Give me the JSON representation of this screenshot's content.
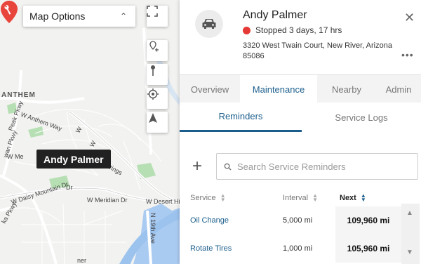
{
  "map": {
    "options_label": "Map Options",
    "labels": {
      "anthem": "ANTHEM",
      "anthem_way": "W Anthem Way",
      "daisy_mountain": "W Daisy Mountain Dr",
      "meridian": "W Meridian Dr",
      "desert_hills": "W Desert Hill",
      "n_19th": "N 19th Ave",
      "peak_pkwy": "Peak Pkwy",
      "wan_pkwy": "wan Pkwy",
      "ka_pkwy": "ka Pkwy",
      "wings": "Wings",
      "w_mir": "W Me",
      "dr": "Dr",
      "w_lone_1": "W",
      "w_lone_2": "W",
      "w_lone_3": "W",
      "ner": "ner"
    },
    "vehicle_tag": "Andy Palmer"
  },
  "vehicle": {
    "name": "Andy Palmer",
    "status": "Stopped 3 days, 17 hrs",
    "status_color": "#e53935",
    "address": "3320 West Twain Court, New River, Arizona 85086"
  },
  "tabs": [
    "Overview",
    "Maintenance",
    "Nearby",
    "Admin"
  ],
  "active_tab": "Maintenance",
  "subtabs": [
    "Reminders",
    "Service Logs"
  ],
  "active_subtab": "Reminders",
  "search": {
    "placeholder": "Search Service Reminders"
  },
  "table": {
    "headers": {
      "service": "Service",
      "interval": "Interval",
      "next": "Next"
    },
    "sorted_by": "Next",
    "rows": [
      {
        "service": "Oil Change",
        "interval": "5,000 mi",
        "next": "109,960 mi"
      },
      {
        "service": "Rotate Tires",
        "interval": "1,000 mi",
        "next": "105,960 mi"
      }
    ]
  },
  "colors": {
    "accent": "#1b5e8c",
    "pin": "#e8453c"
  }
}
